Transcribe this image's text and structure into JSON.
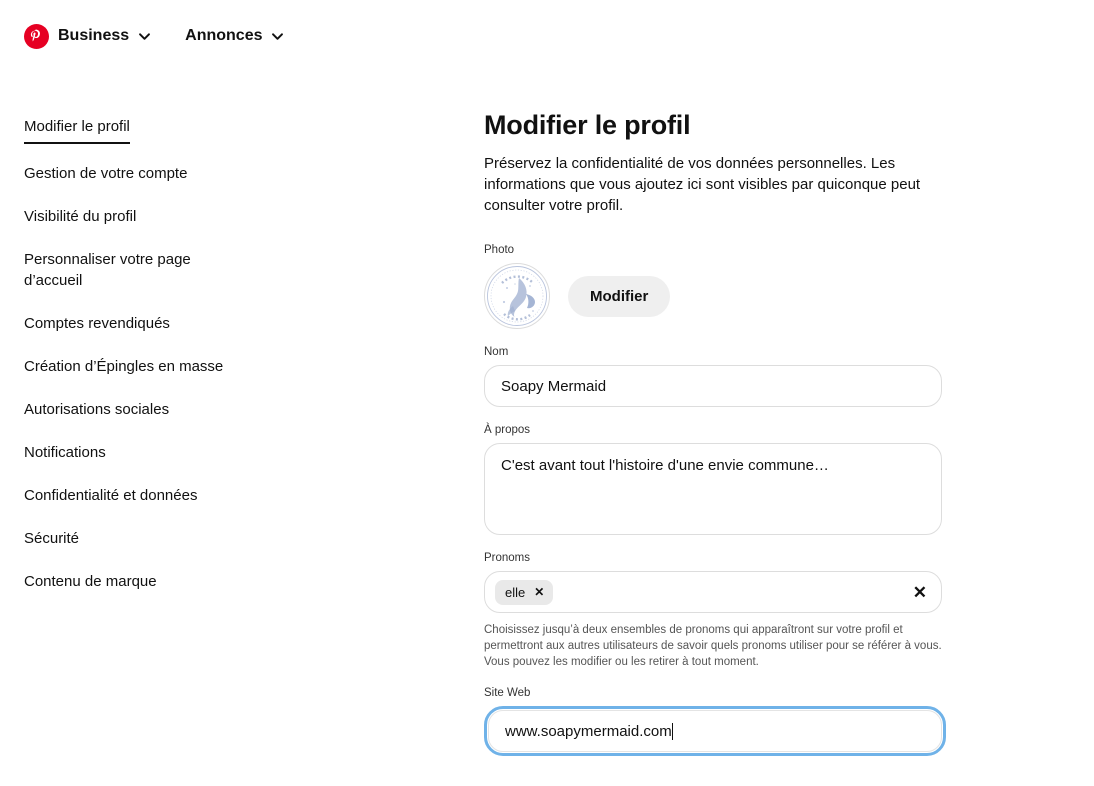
{
  "header": {
    "logo_icon": "pinterest-logo-icon",
    "business_label": "Business",
    "annonces_label": "Annonces",
    "chevron_icon": "chevron-down-icon",
    "brand_color": "#e60023"
  },
  "sidebar": {
    "items": [
      {
        "label": "Modifier le profil",
        "active": true
      },
      {
        "label": "Gestion de votre compte",
        "active": false
      },
      {
        "label": "Visibilité du profil",
        "active": false
      },
      {
        "label": "Personnaliser votre page d’accueil",
        "active": false
      },
      {
        "label": "Comptes revendiqués",
        "active": false
      },
      {
        "label": "Création d’Épingles en masse",
        "active": false
      },
      {
        "label": "Autorisations sociales",
        "active": false
      },
      {
        "label": "Notifications",
        "active": false
      },
      {
        "label": "Confidentialité et données",
        "active": false
      },
      {
        "label": "Sécurité",
        "active": false
      },
      {
        "label": "Contenu de marque",
        "active": false
      }
    ]
  },
  "main": {
    "title": "Modifier le profil",
    "description": "Préservez la confidentialité de vos données personnelles. Les informations que vous ajoutez ici sont visibles par quiconque peut consulter votre profil.",
    "photo": {
      "label": "Photo",
      "avatar_icon": "mermaid-avatar",
      "edit_button": "Modifier"
    },
    "name": {
      "label": "Nom",
      "value": "Soapy Mermaid",
      "placeholder": "Nom"
    },
    "about": {
      "label": "À propos",
      "value": "C'est avant tout l'histoire d'une envie commune…",
      "placeholder": "À propos"
    },
    "pronouns": {
      "label": "Pronoms",
      "tags": [
        "elle"
      ],
      "tag_remove_icon": "close-icon",
      "clear_icon": "close-icon",
      "help": "Choisissez jusqu’à deux ensembles de pronoms qui apparaîtront sur votre profil et permettront aux autres utilisateurs de savoir quels pronoms utiliser pour se référer à vous. Vous pouvez les modifier ou les retirer à tout moment."
    },
    "website": {
      "label": "Site Web",
      "value": "www.soapymermaid.com",
      "placeholder": "Site Web",
      "focus_color": "#6fb2e8",
      "focused": true
    }
  }
}
